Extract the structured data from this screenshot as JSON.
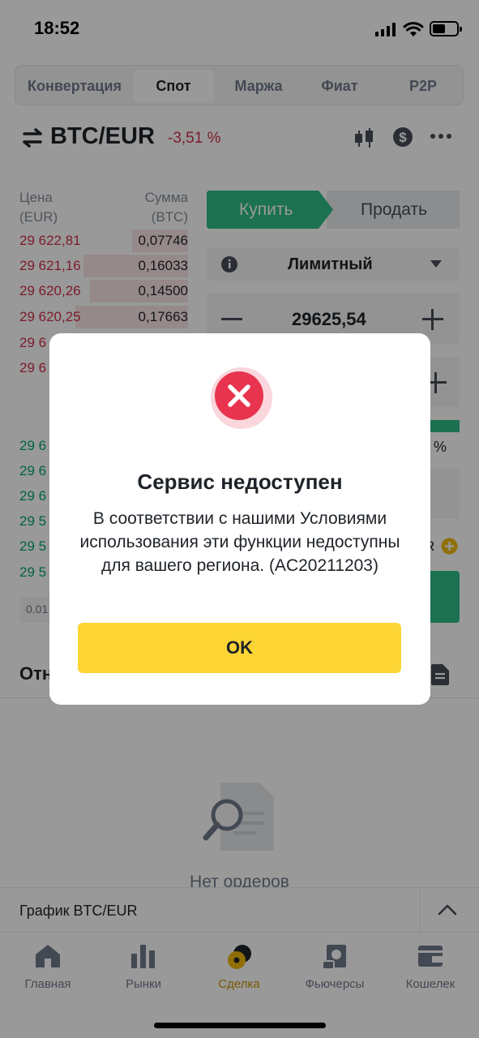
{
  "status": {
    "time": "18:52"
  },
  "tabs": [
    {
      "label": "Конвертация"
    },
    {
      "label": "Спот"
    },
    {
      "label": "Маржа"
    },
    {
      "label": "Фиат"
    },
    {
      "label": "P2P"
    }
  ],
  "pair": {
    "symbol": "BTC/EUR",
    "change": "-3,51 %"
  },
  "orderbook": {
    "price_header": "Цена\n(EUR)",
    "amount_header": "Сумма\n(BTC)",
    "asks": [
      {
        "price": "29 622,81",
        "amount": "0,07746",
        "depth": 0.33
      },
      {
        "price": "29 621,16",
        "amount": "0,16033",
        "depth": 0.62
      },
      {
        "price": "29 620,26",
        "amount": "0,14500",
        "depth": 0.58
      },
      {
        "price": "29 620,25",
        "amount": "0,17663",
        "depth": 0.67
      },
      {
        "price": "29 6",
        "amount": "",
        "depth": 0.2
      },
      {
        "price": "29 6",
        "amount": "",
        "depth": 0.2
      }
    ],
    "bids": [
      {
        "price": "29 6"
      },
      {
        "price": "29 6"
      },
      {
        "price": "29 6"
      },
      {
        "price": "29 5"
      },
      {
        "price": "29 5"
      },
      {
        "price": "29 5"
      }
    ],
    "depth_select": "0.01"
  },
  "trade": {
    "buy_label": "Купить",
    "sell_label": "Продать",
    "order_type": "Лимитный",
    "price_value": "29625,54",
    "percent_fragment": "0 %",
    "balance_fragment": "R"
  },
  "orders": {
    "title_fragment": "Отн",
    "empty_text": "Нет ордеров"
  },
  "chart_bar": {
    "label": "График BTC/EUR"
  },
  "nav": [
    {
      "label": "Главная",
      "icon": "home-icon"
    },
    {
      "label": "Рынки",
      "icon": "markets-icon"
    },
    {
      "label": "Сделка",
      "icon": "trade-icon",
      "active": true
    },
    {
      "label": "Фьючерсы",
      "icon": "futures-icon"
    },
    {
      "label": "Кошелек",
      "icon": "wallet-icon"
    }
  ],
  "modal": {
    "title": "Сервис недоступен",
    "body": "В соответствии с нашими Условиями использования эти функции недоступны для вашего региона. (AC20211203)",
    "ok_label": "OK"
  },
  "colors": {
    "accent": "#fcd535",
    "buy": "#2ebd85",
    "sell": "#cf304a",
    "error": "#e8344e"
  }
}
